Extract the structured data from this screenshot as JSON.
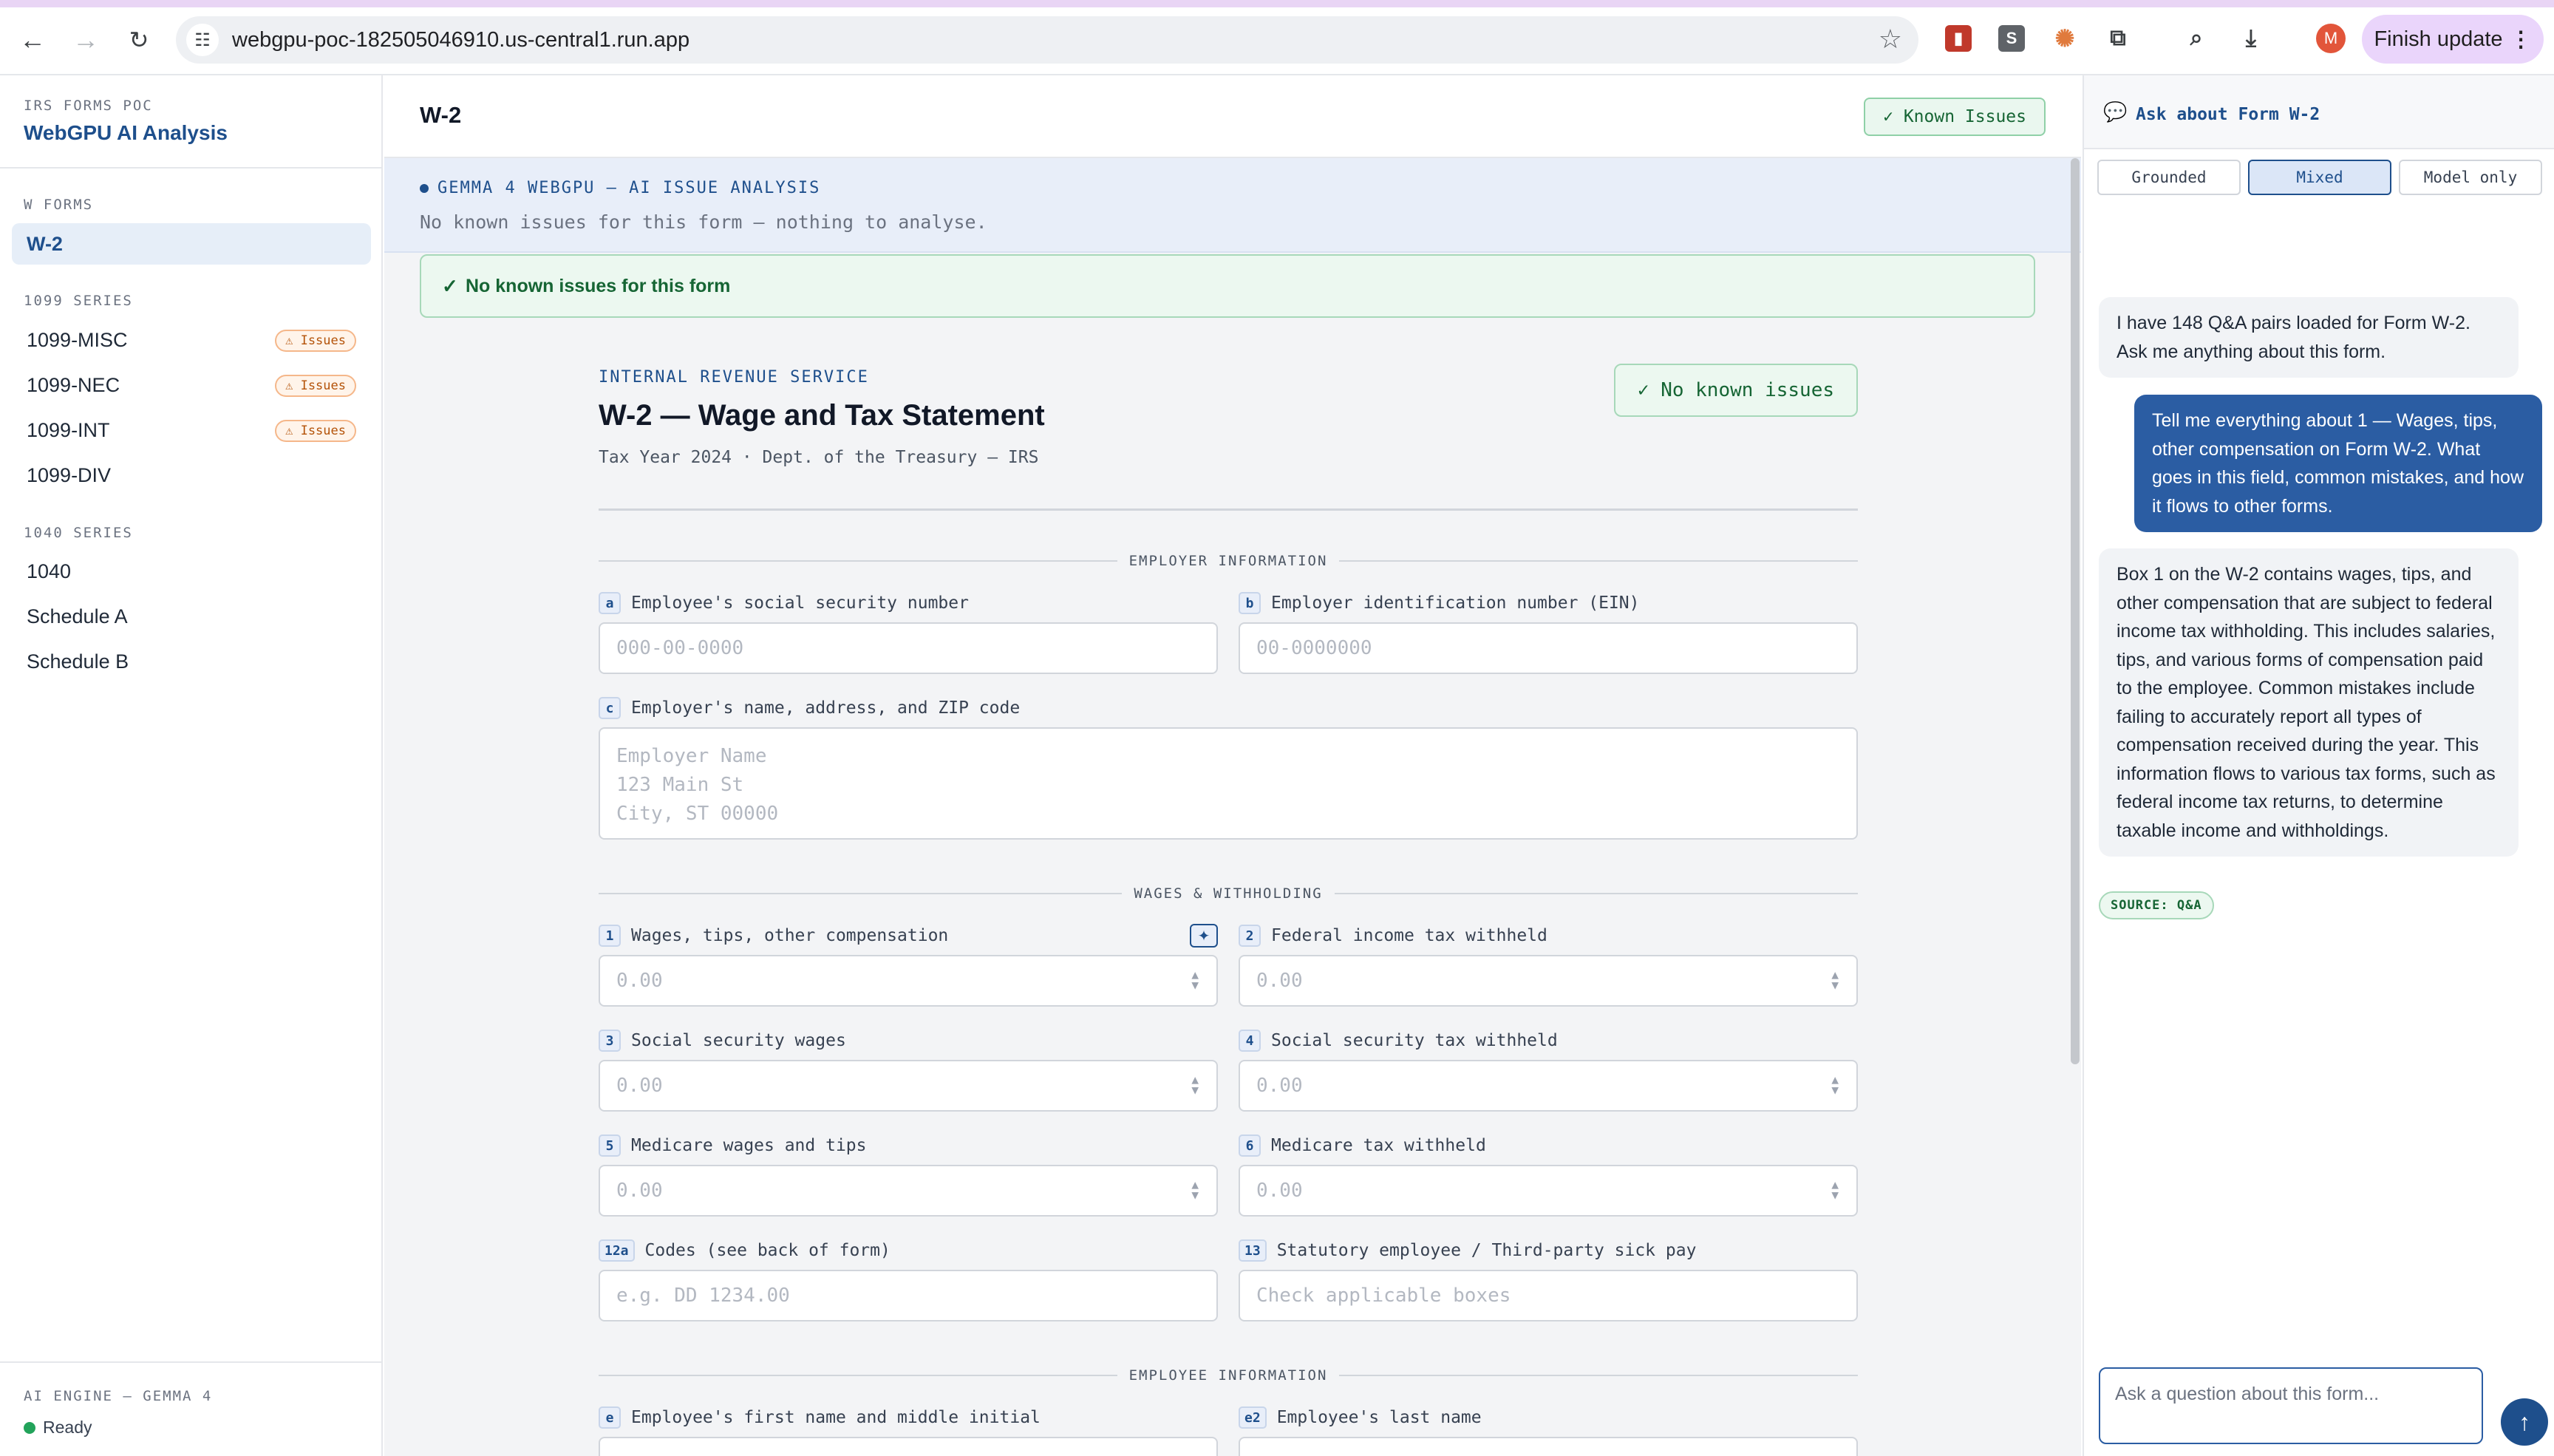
{
  "browser": {
    "url": "webgpu-poc-182505046910.us-central1.run.app",
    "profile_initial": "M",
    "finish_update_label": "Finish update",
    "ext_s_label": "S"
  },
  "sidebar": {
    "project_label": "IRS FORMS POC",
    "app_title": "WebGPU AI Analysis",
    "sections": [
      {
        "title": "W FORMS",
        "items": [
          {
            "label": "W-2",
            "badge": ""
          }
        ]
      },
      {
        "title": "1099 SERIES",
        "items": [
          {
            "label": "1099-MISC",
            "badge": "⚠ Issues"
          },
          {
            "label": "1099-NEC",
            "badge": "⚠ Issues"
          },
          {
            "label": "1099-INT",
            "badge": "⚠ Issues"
          },
          {
            "label": "1099-DIV",
            "badge": ""
          }
        ]
      },
      {
        "title": "1040 SERIES",
        "items": [
          {
            "label": "1040",
            "badge": ""
          },
          {
            "label": "Schedule A",
            "badge": ""
          },
          {
            "label": "Schedule B",
            "badge": ""
          }
        ]
      }
    ],
    "engine_label": "AI ENGINE — GEMMA 4",
    "engine_status": "Ready"
  },
  "main": {
    "title": "W-2",
    "known_issues_button": "✓ Known Issues",
    "ai_banner_label": "GEMMA 4 WEBGPU — AI ISSUE ANALYSIS",
    "ai_banner_text": "No known issues for this form — nothing to analyse.",
    "no_issues_box": "No known issues for this form",
    "form": {
      "agency": "INTERNAL REVENUE SERVICE",
      "title": "W-2 — Wage and Tax Statement",
      "subtitle": "Tax Year 2024 · Dept. of the Treasury — IRS",
      "status_badge": "✓ No known issues",
      "sections": {
        "employer": "EMPLOYER INFORMATION",
        "wages": "WAGES & WITHHOLDING",
        "employee": "EMPLOYEE INFORMATION"
      },
      "fields": {
        "a": {
          "box": "a",
          "label": "Employee's social security number",
          "placeholder": "000-00-0000"
        },
        "b": {
          "box": "b",
          "label": "Employer identification number (EIN)",
          "placeholder": "00-0000000"
        },
        "c": {
          "box": "c",
          "label": "Employer's name, address, and ZIP code",
          "placeholder_lines": [
            "Employer Name",
            "123 Main St",
            "City, ST 00000"
          ]
        },
        "f1": {
          "box": "1",
          "label": "Wages, tips, other compensation",
          "placeholder": "0.00"
        },
        "f2": {
          "box": "2",
          "label": "Federal income tax withheld",
          "placeholder": "0.00"
        },
        "f3": {
          "box": "3",
          "label": "Social security wages",
          "placeholder": "0.00"
        },
        "f4": {
          "box": "4",
          "label": "Social security tax withheld",
          "placeholder": "0.00"
        },
        "f5": {
          "box": "5",
          "label": "Medicare wages and tips",
          "placeholder": "0.00"
        },
        "f6": {
          "box": "6",
          "label": "Medicare tax withheld",
          "placeholder": "0.00"
        },
        "f12a": {
          "box": "12a",
          "label": "Codes (see back of form)",
          "placeholder": "e.g. DD 1234.00"
        },
        "f13": {
          "box": "13",
          "label": "Statutory employee / Third-party sick pay",
          "placeholder": "Check applicable boxes"
        },
        "e": {
          "box": "e",
          "label": "Employee's first name and middle initial"
        },
        "e2": {
          "box": "e2",
          "label": "Employee's last name"
        }
      }
    }
  },
  "chat": {
    "title": "Ask about Form W-2",
    "modes": [
      "Grounded",
      "Mixed",
      "Model only"
    ],
    "active_mode": "Mixed",
    "messages": [
      {
        "role": "assistant",
        "text": "I have 148 Q&A pairs loaded for Form W-2. Ask me anything about this form."
      },
      {
        "role": "user",
        "text": "Tell me everything about 1 — Wages, tips, other compensation on Form W-2. What goes in this field, common mistakes, and how it flows to other forms."
      },
      {
        "role": "assistant",
        "text": "Box 1 on the W-2 contains wages, tips, and other compensation that are subject to federal income tax withholding. This includes salaries, tips, and various forms of compensation paid to the employee. Common mistakes include failing to accurately report all types of compensation received during the year. This information flows to various tax forms, such as federal income tax returns, to determine taxable income and withholdings."
      }
    ],
    "source_badge": "SOURCE: Q&A",
    "input_placeholder": "Ask a question about this form...",
    "send_icon": "↑"
  },
  "colors": {
    "accent": "#1e4f8c",
    "success": "#166534",
    "warning": "#b45309",
    "user_bubble": "#2b5da3"
  }
}
